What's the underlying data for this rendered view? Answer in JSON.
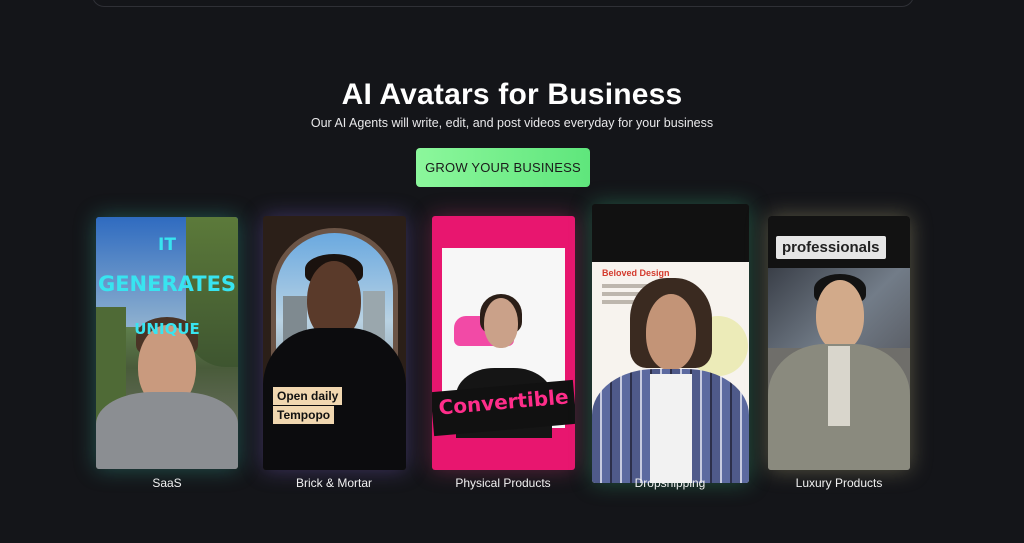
{
  "hero": {
    "title": "AI Avatars for Business",
    "subtitle": "Our AI Agents will write, edit, and post videos everyday for your business",
    "cta_label": "GROW YOUR BUSINESS"
  },
  "cards": [
    {
      "caption": "SaaS",
      "overlay": [
        "IT",
        "GENERATES",
        "UNIQUE"
      ]
    },
    {
      "caption": "Brick & Mortar",
      "overlay": [
        "Open daily",
        "Tempopo"
      ]
    },
    {
      "caption": "Physical Products",
      "overlay": [
        "Convertible"
      ]
    },
    {
      "caption": "Dropshipping",
      "overlay": [
        "Beloved Design"
      ]
    },
    {
      "caption": "Luxury Products",
      "overlay": [
        "professionals"
      ]
    }
  ],
  "colors": {
    "background": "#141519",
    "cta": "#6ef07f",
    "pink": "#e8166f",
    "cyan_text": "#38e4f0"
  }
}
